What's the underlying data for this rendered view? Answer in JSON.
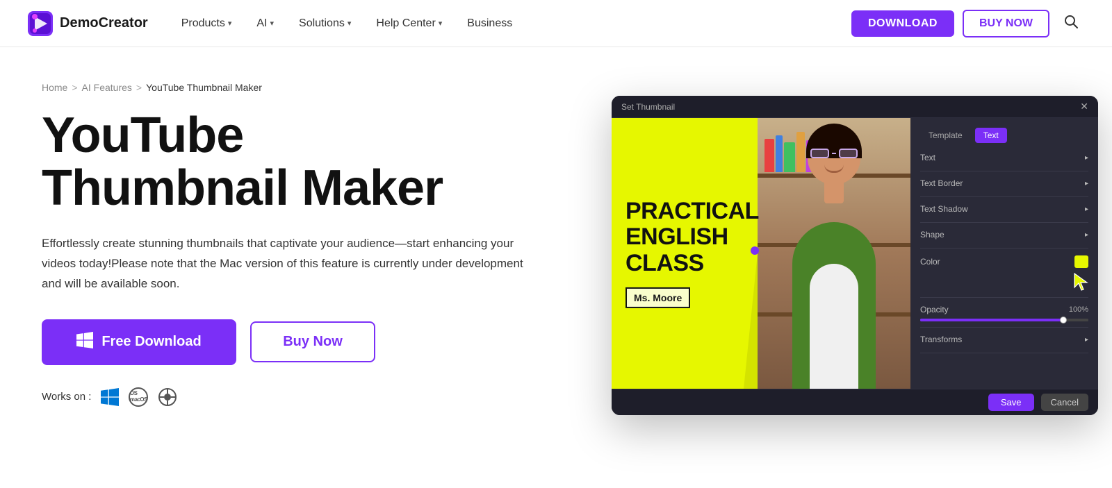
{
  "brand": {
    "name": "DemoCreator",
    "logo_alt": "DemoCreator Logo"
  },
  "navbar": {
    "products_label": "Products",
    "ai_label": "AI",
    "solutions_label": "Solutions",
    "help_center_label": "Help Center",
    "business_label": "Business",
    "download_label": "DOWNLOAD",
    "buy_now_label": "BUY NOW"
  },
  "breadcrumb": {
    "home": "Home",
    "ai_features": "AI Features",
    "current": "YouTube Thumbnail Maker"
  },
  "hero": {
    "title_line1": "YouTube",
    "title_line2": "Thumbnail Maker",
    "description": "Effortlessly create stunning thumbnails that captivate your audience—start enhancing your videos today!Please note that the Mac version of this feature is currently under development and will be available soon.",
    "free_download_label": "Free Download",
    "buy_now_label": "Buy Now",
    "works_on_label": "Works on :"
  },
  "app_preview": {
    "titlebar_text": "Set Thumbnail",
    "close_btn": "✕",
    "tabs": {
      "template_label": "Template",
      "text_label": "Text"
    },
    "settings": {
      "text_label": "Text",
      "text_border_label": "Text Border",
      "text_shadow_label": "Text Shadow",
      "shape_label": "Shape",
      "color_label": "Color",
      "opacity_label": "Opacity",
      "transforms_label": "Transforms"
    },
    "thumbnail": {
      "main_text_line1": "PRACTICAL",
      "main_text_line2": "ENGLISH",
      "main_text_line3": "CLASS",
      "subtitle": "Ms. Moore"
    },
    "footer": {
      "save_label": "Save",
      "cancel_label": "Cancel"
    }
  },
  "colors": {
    "purple": "#7b2ff7",
    "yellow": "#e6f700",
    "dark_bg": "#1e1e2a"
  }
}
